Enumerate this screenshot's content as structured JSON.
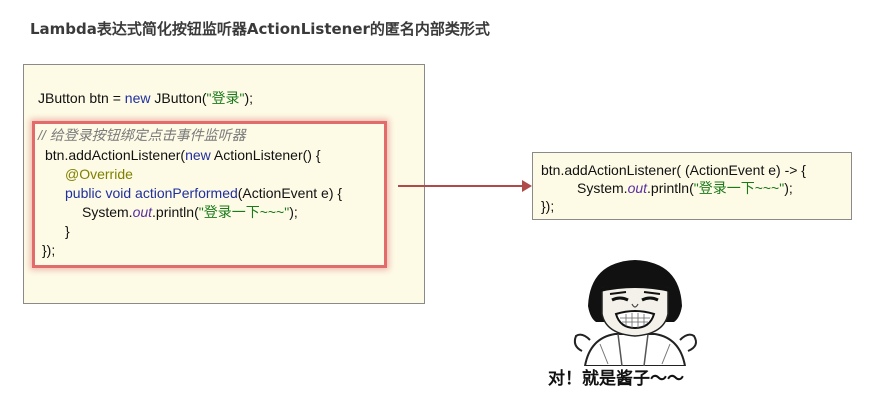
{
  "slide": {
    "title": "Lambda表达式简化按钮监听器ActionListener的匿名内部类形式"
  },
  "left_code": {
    "line1": {
      "a": "JButton btn = ",
      "b": "new",
      "c": " JButton(",
      "d": "\"登录\"",
      "e": ");"
    },
    "comment": "// 给登录按钮绑定点击事件监听器",
    "line3": {
      "a": "btn.addActionListener(",
      "b": "new",
      "c": " ActionListener() {"
    },
    "annotation": "@Override",
    "line5": {
      "a": "public void ",
      "b": "actionPerformed",
      "c": "(ActionEvent e) {"
    },
    "line6": {
      "a": "System.",
      "b": "out",
      "c": ".println(",
      "d": "\"登录一下~~~\"",
      "e": ");"
    },
    "line7": "}",
    "line8": "});"
  },
  "right_code": {
    "line1": "btn.addActionListener( (ActionEvent e) -> {",
    "line2": {
      "a": "System.",
      "b": "out",
      "c": ".println(",
      "d": "\"登录一下~~~\"",
      "e": ");"
    },
    "line3": "});"
  },
  "meme": {
    "caption": "对！就是酱子～～"
  },
  "colors": {
    "code_bg": "#fdfbe6",
    "highlight": "#e26b6b",
    "arrow": "#b04a4a",
    "keyword": "#1f2fa0",
    "string": "#1a7a1a",
    "annotation": "#808000",
    "comment": "#7a7a7a"
  }
}
